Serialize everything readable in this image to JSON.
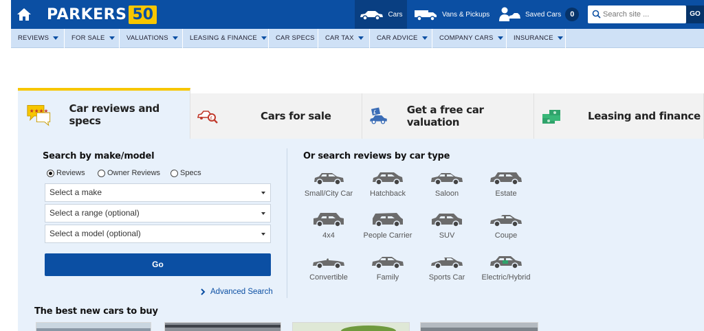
{
  "topbar": {
    "logo_word": "PARKERS",
    "logo_badge": "50",
    "nav": [
      {
        "label": "Cars",
        "icon": "car-icon"
      },
      {
        "label": "Vans & Pickups",
        "icon": "van-icon"
      },
      {
        "label": "Saved Cars",
        "icon": "saved-cars-icon",
        "count": "0"
      }
    ],
    "search_placeholder": "Search site ...",
    "go_label": "GO"
  },
  "subnav": [
    {
      "label": "REVIEWS",
      "dropdown": true
    },
    {
      "label": "FOR SALE",
      "dropdown": true
    },
    {
      "label": "VALUATIONS",
      "dropdown": true
    },
    {
      "label": "LEASING & FINANCE",
      "dropdown": true
    },
    {
      "label": "CAR SPECS",
      "dropdown": false
    },
    {
      "label": "CAR TAX",
      "dropdown": true
    },
    {
      "label": "CAR ADVICE",
      "dropdown": true
    },
    {
      "label": "COMPANY CARS",
      "dropdown": true
    },
    {
      "label": "INSURANCE",
      "dropdown": true
    }
  ],
  "tabs": [
    {
      "label": "Car reviews and specs",
      "icon": "speech-bubble-stars-icon",
      "active": true
    },
    {
      "label": "Cars for sale",
      "icon": "car-search-icon",
      "active": false
    },
    {
      "label": "Get a free car valuation",
      "icon": "car-valuation-icon",
      "active": false
    },
    {
      "label": "Leasing and finance",
      "icon": "money-stack-icon",
      "active": false
    }
  ],
  "search": {
    "heading": "Search by make/model",
    "radios": [
      {
        "label": "Reviews",
        "checked": true
      },
      {
        "label": "Owner Reviews",
        "checked": false
      },
      {
        "label": "Specs",
        "checked": false
      }
    ],
    "selects": [
      "Select a make",
      "Select a range (optional)",
      "Select a model (optional)"
    ],
    "go": "Go",
    "advanced": "Advanced Search"
  },
  "types": {
    "heading": "Or search reviews by car type",
    "items": [
      {
        "label": "Small/City Car",
        "icon": "small-car-icon"
      },
      {
        "label": "Hatchback",
        "icon": "hatchback-icon"
      },
      {
        "label": "Saloon",
        "icon": "saloon-icon"
      },
      {
        "label": "Estate",
        "icon": "estate-icon"
      },
      {
        "label": "4x4",
        "icon": "4x4-icon"
      },
      {
        "label": "People Carrier",
        "icon": "people-carrier-icon"
      },
      {
        "label": "SUV",
        "icon": "suv-icon"
      },
      {
        "label": "Coupe",
        "icon": "coupe-icon"
      },
      {
        "label": "Convertible",
        "icon": "convertible-icon"
      },
      {
        "label": "Family",
        "icon": "family-car-icon"
      },
      {
        "label": "Sports Car",
        "icon": "sports-car-icon"
      },
      {
        "label": "Electric/Hybrid",
        "icon": "electric-car-icon"
      }
    ]
  },
  "best_new": {
    "heading": "The best new cars to buy"
  },
  "colors": {
    "primary": "#0b4fa3",
    "accent": "#f7c600",
    "panel": "#e8f1fb",
    "subnav": "#cfe1f6"
  }
}
